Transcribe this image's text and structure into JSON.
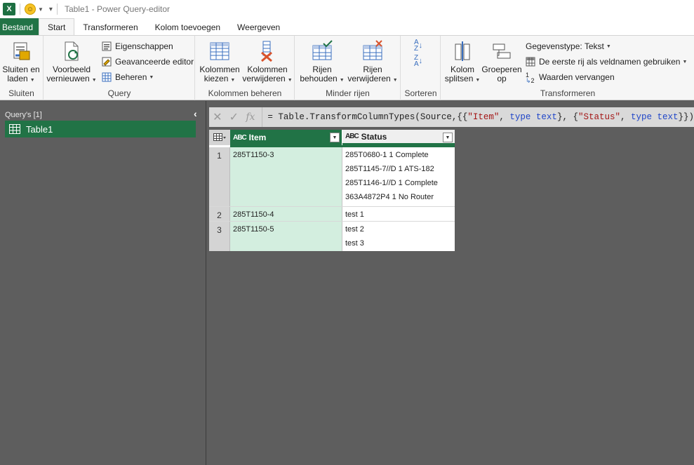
{
  "titlebar": {
    "app_icon": "X",
    "title": "Table1 - Power Query-editor"
  },
  "tabs": [
    "Bestand",
    "Start",
    "Transformeren",
    "Kolom toevoegen",
    "Weergeven"
  ],
  "ribbon": {
    "sluiten": {
      "button": [
        "Sluiten en",
        "laden"
      ],
      "label": "Sluiten"
    },
    "query": {
      "refresh": [
        "Voorbeeld",
        "vernieuwen"
      ],
      "properties": "Eigenschappen",
      "advanced_editor": "Geavanceerde editor",
      "manage": "Beheren",
      "label": "Query"
    },
    "kolommen": {
      "choose": [
        "Kolommen",
        "kiezen"
      ],
      "remove": [
        "Kolommen",
        "verwijderen"
      ],
      "label": "Kolommen beheren"
    },
    "rijen": {
      "keep": [
        "Rijen",
        "behouden"
      ],
      "remove": [
        "Rijen",
        "verwijderen"
      ],
      "label": "Minder rijen"
    },
    "sorteren": {
      "label": "Sorteren"
    },
    "transformeren": {
      "split": [
        "Kolom",
        "splitsen"
      ],
      "group": [
        "Groeperen",
        "op"
      ],
      "datatype": "Gegevenstype: Tekst",
      "first_row": "De eerste rij als veldnamen gebruiken",
      "replace": "Waarden vervangen",
      "label": "Transformeren"
    }
  },
  "queries": {
    "title": "Query's [1]",
    "items": [
      "Table1"
    ]
  },
  "formula": {
    "prefix": "= Table.TransformColumnTypes(Source,{{",
    "s1": "\"Item\"",
    "mid1": ", ",
    "kw1": "type text",
    "mid2": "}, {",
    "s2": "\"Status\"",
    "mid3": ", ",
    "kw2": "type text",
    "suffix": "}})"
  },
  "grid": {
    "columns": [
      {
        "type": "ABC",
        "name": "Item"
      },
      {
        "type": "ABC",
        "name": "Status"
      }
    ],
    "rows": [
      {
        "num": "1",
        "item": "285T1150-3",
        "status": [
          "285T0680-1 1 Complete",
          "285T1145-7//D 1 ATS-182",
          "285T1146-1//D 1 Complete",
          "363A4872P4 1 No Router"
        ]
      },
      {
        "num": "2",
        "item": "285T1150-4",
        "status": [
          "test 1"
        ]
      },
      {
        "num": "3",
        "item": "285T1150-5",
        "status": [
          "test 2",
          "test 3"
        ]
      }
    ]
  },
  "colors": {
    "accent": "#217346",
    "item_cell": "#d3eedf"
  }
}
